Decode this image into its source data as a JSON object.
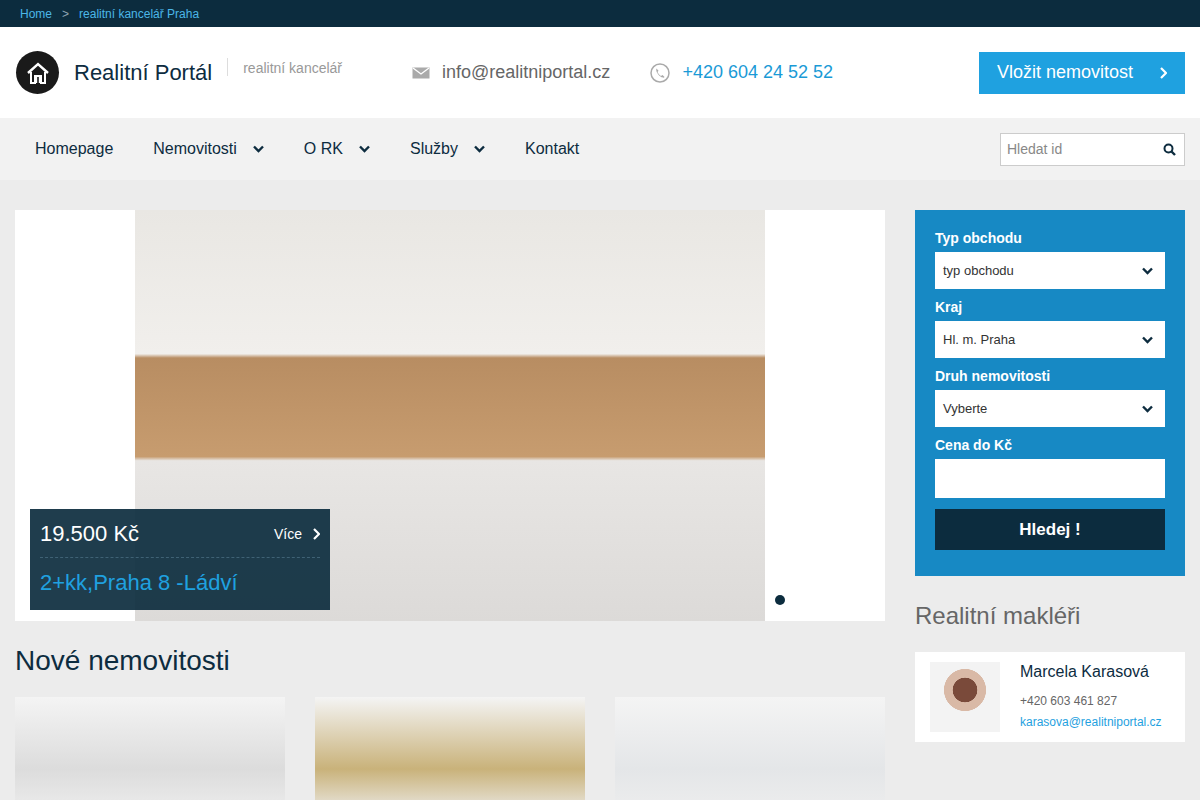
{
  "breadcrumb": {
    "items": [
      {
        "label": "Home"
      },
      {
        "label": "realitní kancelář Praha"
      }
    ],
    "separator": ">"
  },
  "header": {
    "title": "Realitní Portál",
    "subtitle": "realitní kancelář",
    "email": "info@realitniportal.cz",
    "phone": "+420 604 24 52 52",
    "cta": "Vložit nemovitost"
  },
  "nav": {
    "items": [
      {
        "label": "Homepage",
        "kind": "link"
      },
      {
        "label": "Nemovitosti",
        "kind": "dropdown"
      },
      {
        "label": "O RK",
        "kind": "dropdown"
      },
      {
        "label": "Služby",
        "kind": "dropdown"
      },
      {
        "label": "Kontakt",
        "kind": "link"
      }
    ],
    "search": {
      "placeholder": "Hledat id"
    }
  },
  "slider": {
    "price": "19.500 Kč",
    "more": "Více",
    "title": "2+kk,Praha 8 -Ládví",
    "dots": [
      {
        "selected": true
      }
    ]
  },
  "search_form": {
    "fields": [
      {
        "label": "Typ obchodu",
        "kind": "select",
        "value": "typ obchodu"
      },
      {
        "label": "Kraj",
        "kind": "select",
        "value": "Hl. m. Praha"
      },
      {
        "label": "Druh nemovitosti",
        "kind": "select",
        "value": "Vyberte"
      },
      {
        "label": "Cena do Kč",
        "kind": "input",
        "value": ""
      }
    ],
    "button": "Hledej !"
  },
  "new_properties": {
    "title": "Nové nemovitosti",
    "cards": [
      {
        "tone": "#dcdcdc"
      },
      {
        "tone": "#c9b27a"
      },
      {
        "tone": "#e4e6e8"
      }
    ]
  },
  "agents": {
    "title": "Realitní makléři",
    "items": [
      {
        "name": "Marcela Karasová",
        "phone": "+420 603 461 827",
        "email": "karasova@realitniportal.cz"
      }
    ]
  }
}
